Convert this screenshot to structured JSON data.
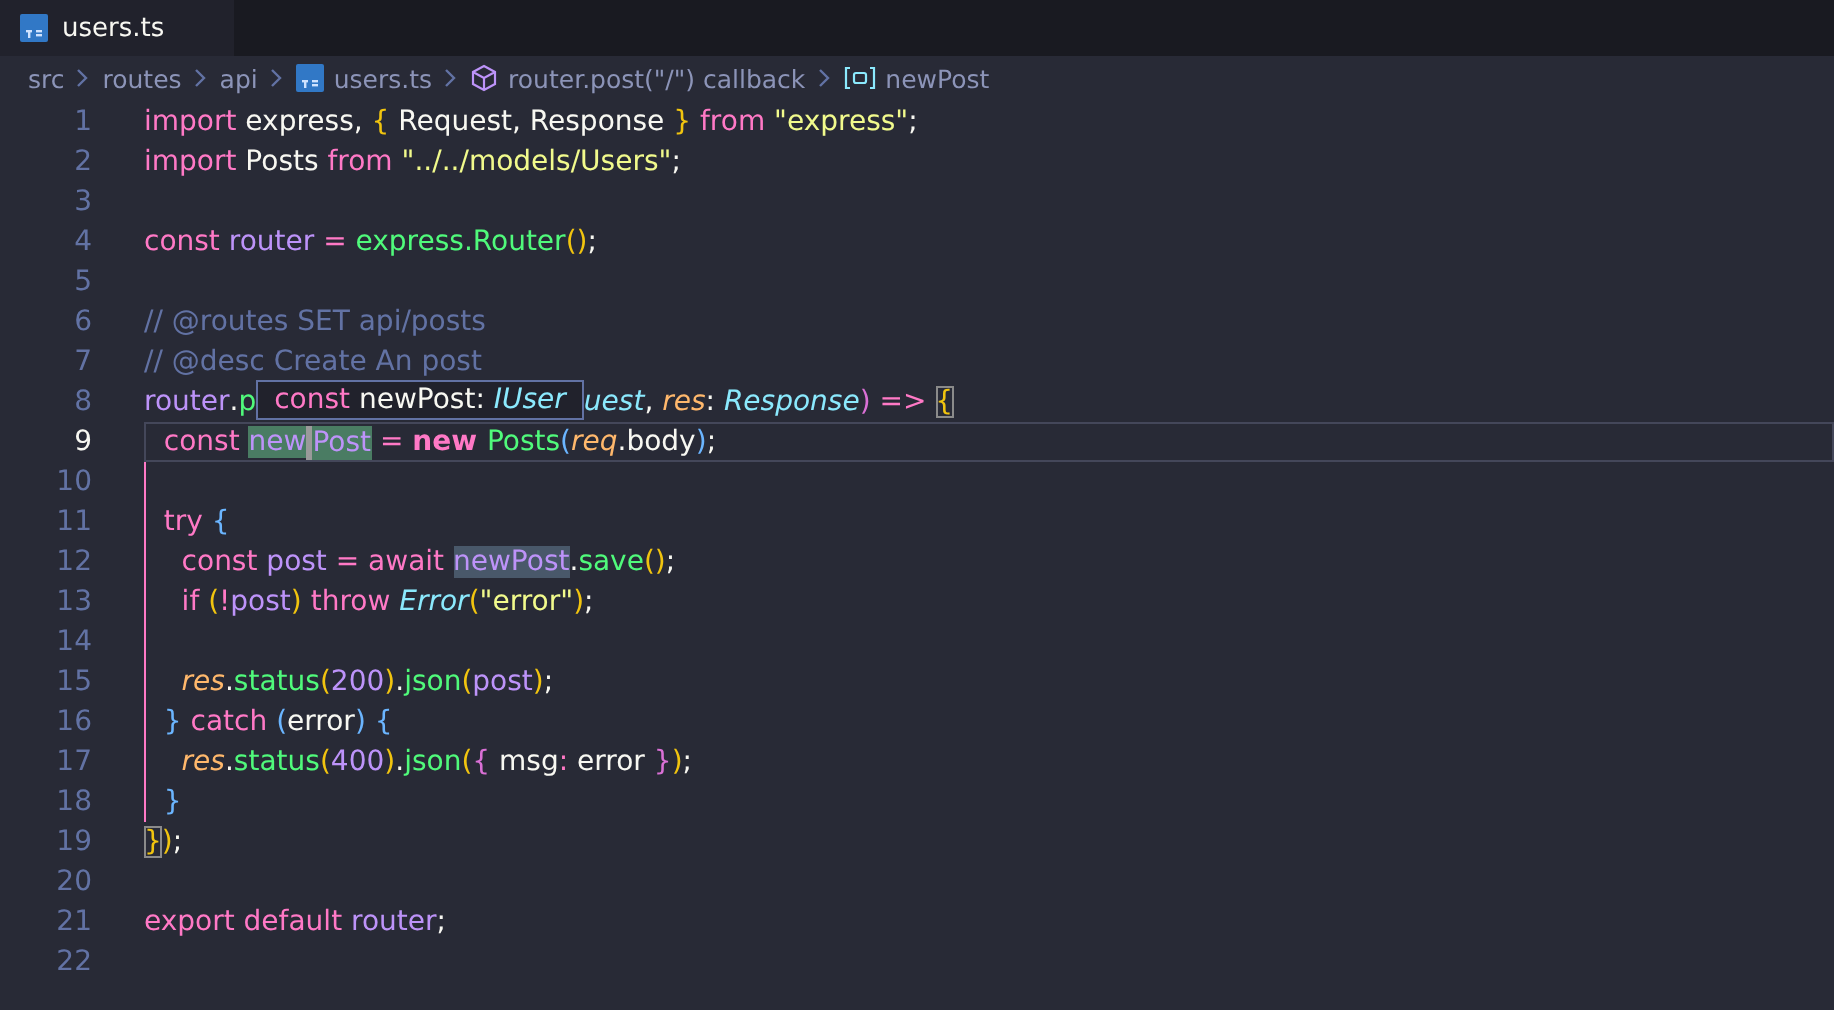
{
  "tabs": [
    {
      "label": "users.ts",
      "selected": true
    }
  ],
  "breadcrumbs": [
    {
      "label": "src",
      "kind": "folder"
    },
    {
      "label": "routes",
      "kind": "folder"
    },
    {
      "label": "api",
      "kind": "folder"
    },
    {
      "label": "users.ts",
      "kind": "file"
    },
    {
      "label": "router.post(\"/\") callback",
      "kind": "function"
    },
    {
      "label": "newPost",
      "kind": "variable"
    }
  ],
  "lines": [
    {
      "number": "1",
      "tokens": [
        {
          "text": "import",
          "kind": "kw"
        },
        {
          "text": " express, ",
          "kind": "text"
        },
        {
          "text": "{",
          "kind": "b1"
        },
        {
          "text": " Request, Response ",
          "kind": "text"
        },
        {
          "text": "}",
          "kind": "b1"
        },
        {
          "text": " from ",
          "kind": "kw"
        },
        {
          "text": "\"express\"",
          "kind": "str"
        },
        {
          "text": ";",
          "kind": "text"
        }
      ]
    },
    {
      "number": "2",
      "tokens": [
        {
          "text": "import",
          "kind": "kw"
        },
        {
          "text": " Posts ",
          "kind": "text"
        },
        {
          "text": "from ",
          "kind": "kw"
        },
        {
          "text": "\"../../models/Users\"",
          "kind": "str"
        },
        {
          "text": ";",
          "kind": "text"
        }
      ]
    },
    {
      "number": "3"
    },
    {
      "number": "4",
      "tokens": [
        {
          "text": "const",
          "kind": "kw"
        },
        {
          "text": " router",
          "kind": "var"
        },
        {
          "text": " = ",
          "kind": "kw"
        },
        {
          "text": "express.Router",
          "kind": "fn"
        },
        {
          "text": "()",
          "kind": "b1"
        },
        {
          "text": ";",
          "kind": "text"
        }
      ]
    },
    {
      "number": "5"
    },
    {
      "number": "6",
      "tokens": [
        {
          "text": "// @routes SET api/posts",
          "kind": "cmt"
        }
      ]
    },
    {
      "number": "7",
      "tokens": [
        {
          "text": "// @desc Create An post",
          "kind": "cmt"
        }
      ]
    },
    {
      "number": "8",
      "tokens": [
        {
          "text": "router",
          "kind": "var"
        },
        {
          "text": ".",
          "kind": "text"
        },
        {
          "text": "p",
          "kind": "fn"
        },
        {
          "kind": "hover",
          "parts": [
            {
              "text": "const ",
              "kind": "kw"
            },
            {
              "text": "newPost",
              "kind": "text"
            },
            {
              "text": ": ",
              "kind": "text"
            },
            {
              "text": "IUser",
              "kind": "type"
            }
          ]
        },
        {
          "text": "uest",
          "kind": "type"
        },
        {
          "text": ", ",
          "kind": "text"
        },
        {
          "text": "res",
          "kind": "param"
        },
        {
          "text": ": ",
          "kind": "text"
        },
        {
          "text": "Response",
          "kind": "type"
        },
        {
          "text": ")",
          "kind": "b2"
        },
        {
          "text": " => ",
          "kind": "kw"
        },
        {
          "text": "{",
          "kind": "b1",
          "matched": true
        }
      ]
    },
    {
      "number": "9",
      "current": true,
      "tokens": [
        {
          "text": "  const ",
          "kind": "kw"
        },
        {
          "text": "new",
          "kind": "var",
          "write_highlight": true
        },
        {
          "text": "Post",
          "kind": "var",
          "write_highlight": true,
          "cursor": true
        },
        {
          "text": " = ",
          "kind": "kw"
        },
        {
          "text": "new ",
          "kind": "kwb"
        },
        {
          "text": "Posts",
          "kind": "fn"
        },
        {
          "text": "(",
          "kind": "b3"
        },
        {
          "text": "req",
          "kind": "param"
        },
        {
          "text": ".body",
          "kind": "text"
        },
        {
          "text": ")",
          "kind": "b3"
        },
        {
          "text": ";",
          "kind": "text"
        }
      ]
    },
    {
      "number": "10",
      "guide": true
    },
    {
      "number": "11",
      "guide": true,
      "tokens": [
        {
          "text": "  try ",
          "kind": "kw"
        },
        {
          "text": "{",
          "kind": "b3"
        }
      ]
    },
    {
      "number": "12",
      "guide": true,
      "tokens": [
        {
          "text": "    const",
          "kind": "kw"
        },
        {
          "text": " post",
          "kind": "var"
        },
        {
          "text": " = await ",
          "kind": "kw"
        },
        {
          "text": "newPost",
          "kind": "var",
          "read_highlight": true
        },
        {
          "text": ".",
          "kind": "text"
        },
        {
          "text": "save",
          "kind": "fn"
        },
        {
          "text": "()",
          "kind": "b1"
        },
        {
          "text": ";",
          "kind": "text"
        }
      ]
    },
    {
      "number": "13",
      "guide": true,
      "tokens": [
        {
          "text": "    if ",
          "kind": "kw"
        },
        {
          "text": "(",
          "kind": "b1"
        },
        {
          "text": "!",
          "kind": "kw"
        },
        {
          "text": "post",
          "kind": "var"
        },
        {
          "text": ")",
          "kind": "b1"
        },
        {
          "text": " throw ",
          "kind": "kw"
        },
        {
          "text": "Error",
          "kind": "type"
        },
        {
          "text": "(",
          "kind": "b1"
        },
        {
          "text": "\"error\"",
          "kind": "str"
        },
        {
          "text": ")",
          "kind": "b1"
        },
        {
          "text": ";",
          "kind": "text"
        }
      ]
    },
    {
      "number": "14",
      "guide": true
    },
    {
      "number": "15",
      "guide": true,
      "tokens": [
        {
          "text": "    res",
          "kind": "param"
        },
        {
          "text": ".",
          "kind": "text"
        },
        {
          "text": "status",
          "kind": "fn"
        },
        {
          "text": "(",
          "kind": "b1"
        },
        {
          "text": "200",
          "kind": "var"
        },
        {
          "text": ")",
          "kind": "b1"
        },
        {
          "text": ".",
          "kind": "text"
        },
        {
          "text": "json",
          "kind": "fn"
        },
        {
          "text": "(",
          "kind": "b1"
        },
        {
          "text": "post",
          "kind": "var"
        },
        {
          "text": ")",
          "kind": "b1"
        },
        {
          "text": ";",
          "kind": "text"
        }
      ]
    },
    {
      "number": "16",
      "guide": true,
      "tokens": [
        {
          "text": "  }",
          "kind": "b3"
        },
        {
          "text": " catch ",
          "kind": "kw"
        },
        {
          "text": "(",
          "kind": "b3"
        },
        {
          "text": "error",
          "kind": "text"
        },
        {
          "text": ")",
          "kind": "b3"
        },
        {
          "text": " {",
          "kind": "b3"
        }
      ]
    },
    {
      "number": "17",
      "guide": true,
      "tokens": [
        {
          "text": "    res",
          "kind": "param"
        },
        {
          "text": ".",
          "kind": "text"
        },
        {
          "text": "status",
          "kind": "fn"
        },
        {
          "text": "(",
          "kind": "b1"
        },
        {
          "text": "400",
          "kind": "var"
        },
        {
          "text": ")",
          "kind": "b1"
        },
        {
          "text": ".",
          "kind": "text"
        },
        {
          "text": "json",
          "kind": "fn"
        },
        {
          "text": "(",
          "kind": "b1"
        },
        {
          "text": "{",
          "kind": "b2"
        },
        {
          "text": " msg",
          "kind": "text"
        },
        {
          "text": ": ",
          "kind": "kw"
        },
        {
          "text": "error ",
          "kind": "text"
        },
        {
          "text": "}",
          "kind": "b2"
        },
        {
          "text": ")",
          "kind": "b1"
        },
        {
          "text": ";",
          "kind": "text"
        }
      ]
    },
    {
      "number": "18",
      "guide": true,
      "tokens": [
        {
          "text": "  }",
          "kind": "b3"
        }
      ]
    },
    {
      "number": "19",
      "tokens": [
        {
          "text": "}",
          "kind": "b1",
          "matched": true
        },
        {
          "text": ")",
          "kind": "b1"
        },
        {
          "text": ";",
          "kind": "text"
        }
      ]
    },
    {
      "number": "20"
    },
    {
      "number": "21",
      "tokens": [
        {
          "text": "export default",
          "kind": "kw"
        },
        {
          "text": " router",
          "kind": "var"
        },
        {
          "text": ";",
          "kind": "text"
        }
      ]
    },
    {
      "number": "22"
    }
  ]
}
